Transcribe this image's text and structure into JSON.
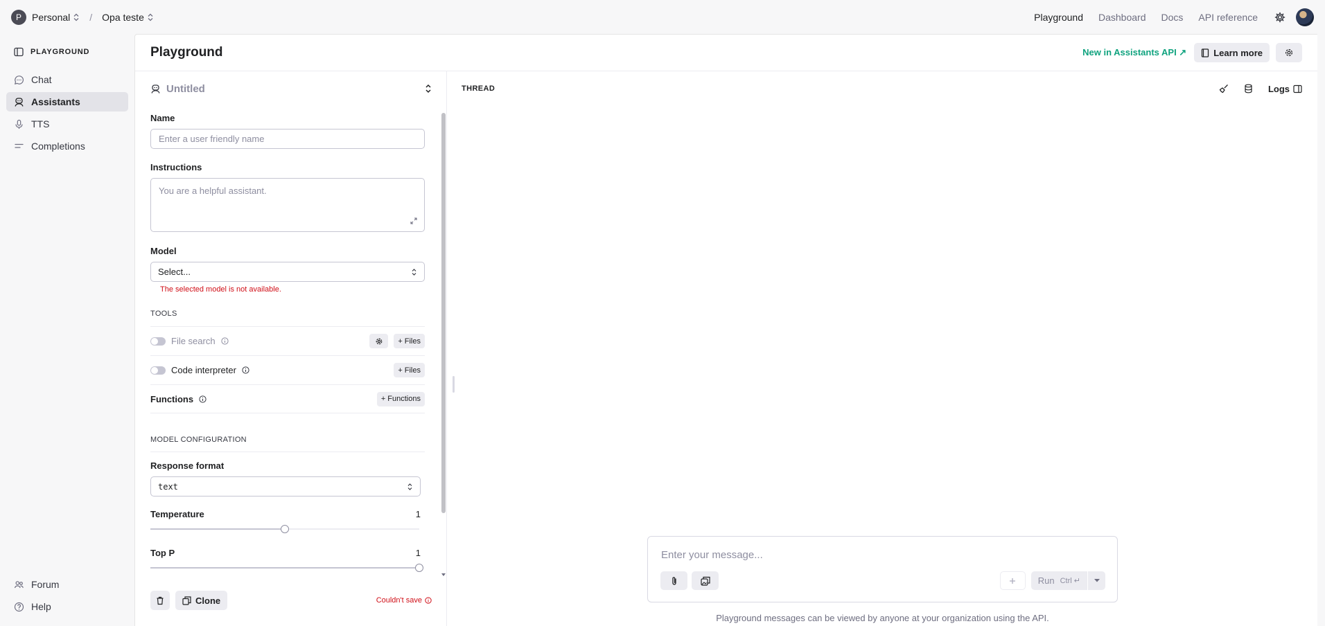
{
  "topbar": {
    "org_initial": "P",
    "org_name": "Personal",
    "separator": "/",
    "project_name": "Opa teste",
    "nav": [
      "Playground",
      "Dashboard",
      "Docs",
      "API reference"
    ]
  },
  "sidebar": {
    "header": "PLAYGROUND",
    "items": [
      {
        "label": "Chat",
        "icon": "chat-bubble-icon"
      },
      {
        "label": "Assistants",
        "icon": "assistant-icon",
        "active": true
      },
      {
        "label": "TTS",
        "icon": "microphone-icon"
      },
      {
        "label": "Completions",
        "icon": "lines-icon"
      }
    ],
    "bottom": [
      {
        "label": "Forum",
        "icon": "people-icon"
      },
      {
        "label": "Help",
        "icon": "help-icon"
      }
    ]
  },
  "main": {
    "title": "Playground",
    "new_link": "New in Assistants API ↗",
    "learn_more": "Learn more"
  },
  "assistant": {
    "name": "Untitled",
    "name_label": "Name",
    "name_placeholder": "Enter a user friendly name",
    "instructions_label": "Instructions",
    "instructions_placeholder": "You are a helpful assistant.",
    "model_label": "Model",
    "model_value": "Select...",
    "model_error": "The selected model is not available.",
    "tools_title": "TOOLS",
    "tools": {
      "file_search": "File search",
      "code_interpreter": "Code interpreter",
      "functions": "Functions",
      "files_btn": "Files",
      "functions_btn": "Functions"
    },
    "config_title": "MODEL CONFIGURATION",
    "response_format_label": "Response format",
    "response_format_value": "text",
    "temperature_label": "Temperature",
    "temperature_value": "1",
    "temperature_fraction": 0.5,
    "top_p_label": "Top P",
    "top_p_value": "1",
    "top_p_fraction": 1.0,
    "clone_btn": "Clone",
    "save_status": "Couldn't save"
  },
  "thread": {
    "title": "THREAD",
    "logs": "Logs",
    "message_placeholder": "Enter your message...",
    "run_label": "Run",
    "run_shortcut": "Ctrl ↵",
    "disclaimer": "Playground messages can be viewed by anyone at your organization using the API."
  },
  "colors": {
    "accent": "#10a37f",
    "error": "#d00e17"
  }
}
